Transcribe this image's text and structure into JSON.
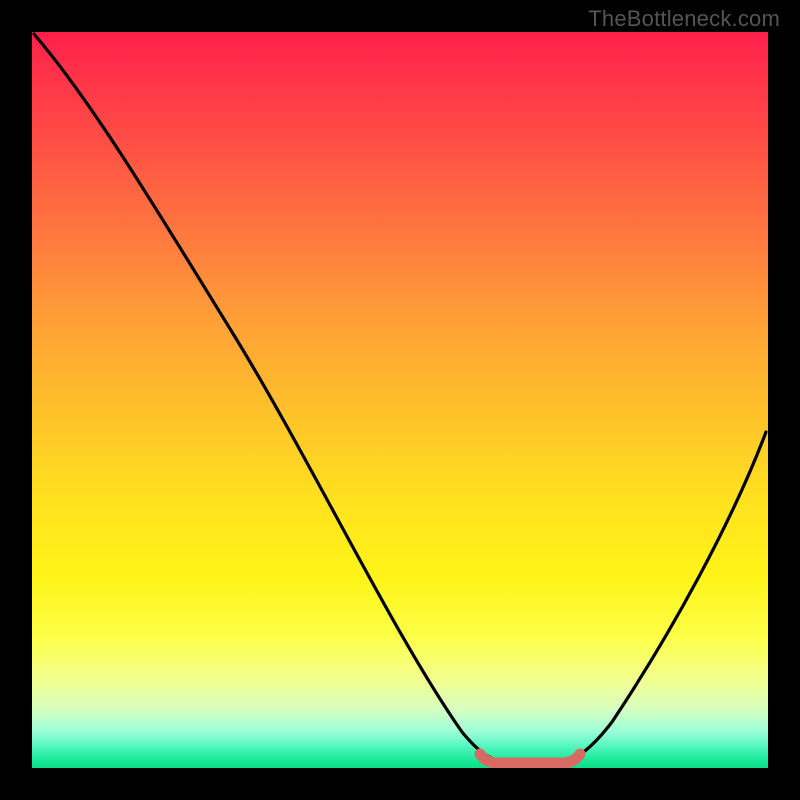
{
  "watermark": "TheBottleneck.com",
  "colors": {
    "frame": "#000000",
    "curve": "#000000",
    "marker": "#d96a63"
  },
  "chart_data": {
    "type": "line",
    "title": "",
    "xlabel": "",
    "ylabel": "",
    "xlim": [
      0,
      100
    ],
    "ylim": [
      0,
      100
    ],
    "grid": false,
    "legend": false,
    "series": [
      {
        "name": "bottleneck-curve",
        "x": [
          0,
          6,
          12,
          18,
          24,
          30,
          36,
          42,
          48,
          54,
          58,
          62,
          64,
          66,
          68,
          70,
          74,
          78,
          84,
          90,
          96,
          100
        ],
        "y": [
          100,
          91,
          82,
          72,
          63,
          53,
          44,
          34,
          24,
          14,
          7,
          2,
          0.7,
          0.5,
          0.5,
          0.7,
          2,
          5,
          13,
          24,
          37,
          47
        ]
      }
    ],
    "marker_segment": {
      "name": "optimal-range",
      "x_start": 61,
      "x_end": 73,
      "y": 0.8
    },
    "annotations": []
  }
}
